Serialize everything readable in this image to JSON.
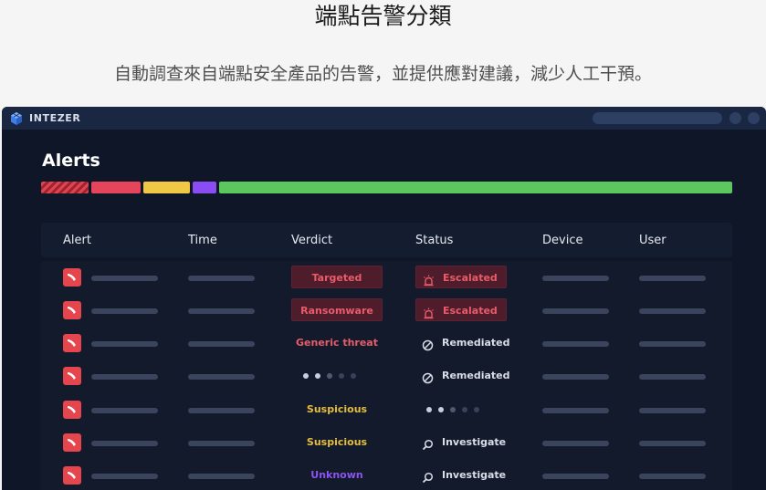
{
  "page": {
    "heading": "端點告警分類",
    "subheading": "自動調查來自端點安全產品的告警，並提供應對建議，減少人工干預。"
  },
  "app": {
    "brand": "INTEZER",
    "title": "Alerts",
    "severity_bar": [
      {
        "level": "critical",
        "color": "#e0434f"
      },
      {
        "level": "high",
        "color": "#e5455a"
      },
      {
        "level": "medium",
        "color": "#f1c845"
      },
      {
        "level": "low",
        "color": "#8a4cf3"
      },
      {
        "level": "ok",
        "color": "#5cc75f"
      }
    ]
  },
  "table": {
    "columns": [
      "Alert",
      "Time",
      "Verdict",
      "Status",
      "Device",
      "User"
    ],
    "rows": [
      {
        "verdict": "Targeted",
        "verdict_style": "badge-red",
        "status": "Escalated",
        "status_icon": "alarm-icon",
        "status_style": "badge-red"
      },
      {
        "verdict": "Ransomware",
        "verdict_style": "badge-red",
        "status": "Escalated",
        "status_icon": "alarm-icon",
        "status_style": "badge-red"
      },
      {
        "verdict": "Generic threat",
        "verdict_style": "text-red",
        "status": "Remediated",
        "status_icon": "prohibited-icon",
        "status_style": "plain"
      },
      {
        "verdict": "",
        "verdict_style": "loading-dots",
        "status": "Remediated",
        "status_icon": "prohibited-icon",
        "status_style": "plain"
      },
      {
        "verdict": "Suspicious",
        "verdict_style": "text-yellow",
        "status": "",
        "status_icon": "loading-dots",
        "status_style": "plain"
      },
      {
        "verdict": "Suspicious",
        "verdict_style": "text-yellow",
        "status": "Investigate",
        "status_icon": "search-icon",
        "status_style": "plain"
      },
      {
        "verdict": "Unknown",
        "verdict_style": "text-purple",
        "status": "Investigate",
        "status_icon": "search-icon",
        "status_style": "plain"
      }
    ]
  }
}
